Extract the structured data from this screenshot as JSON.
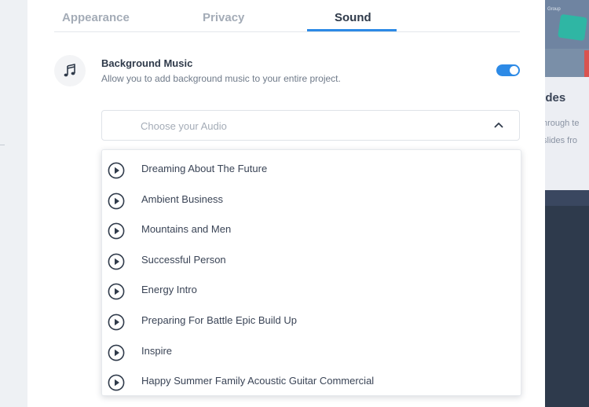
{
  "tabs": [
    {
      "label": "Appearance",
      "active": false
    },
    {
      "label": "Privacy",
      "active": false
    },
    {
      "label": "Sound",
      "active": true
    }
  ],
  "background_music": {
    "title": "Background Music",
    "description": "Allow you to add background music to your entire project.",
    "enabled": true,
    "icon": "music-note-icon"
  },
  "audio_select": {
    "placeholder": "Choose your Audio",
    "expanded": true,
    "icon": "chevron-up-icon"
  },
  "tracks": [
    "Dreaming About The Future",
    "Ambient Business",
    "Mountains and Men",
    "Successful Person",
    "Energy Intro",
    "Preparing For Battle Epic Build Up",
    "Inspire",
    "Happy Summer Family Acoustic Guitar Commercial"
  ],
  "background_page": {
    "thumb_caption": "Group",
    "title_fragment": "lides",
    "desc_line1": "hrough te",
    "desc_line2": "slides fro"
  },
  "colors": {
    "accent": "#2d8ae6",
    "text_dark": "#2f3a4a",
    "text_muted": "#a4acb7"
  }
}
